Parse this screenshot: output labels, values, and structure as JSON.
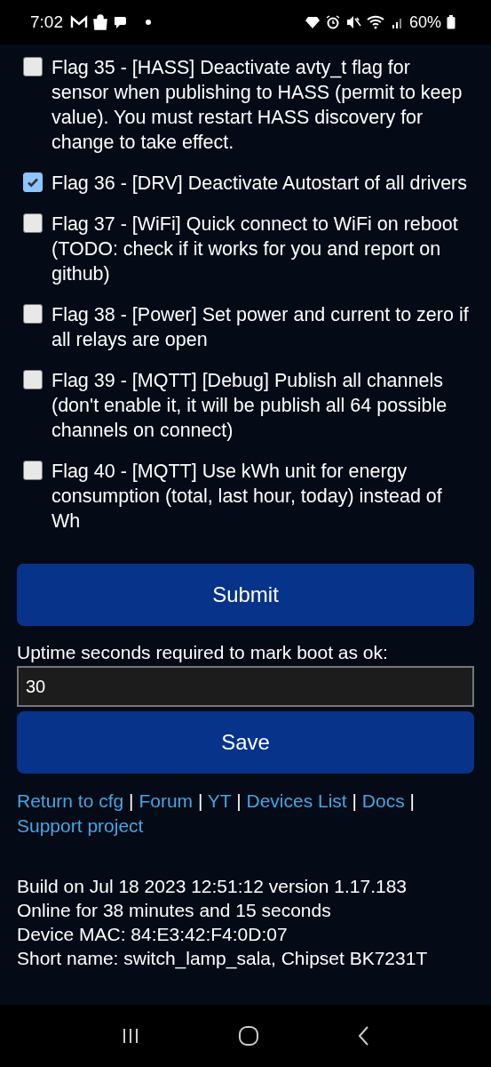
{
  "status_bar": {
    "time": "7:02",
    "battery": "60%"
  },
  "flags": [
    {
      "label": "Flag 35 - [HASS] Deactivate avty_t flag for sensor when publishing to HASS (permit to keep value). You must restart HASS discovery for change to take effect.",
      "checked": false
    },
    {
      "label": "Flag 36 - [DRV] Deactivate Autostart of all drivers",
      "checked": true
    },
    {
      "label": "Flag 37 - [WiFi] Quick connect to WiFi on reboot (TODO: check if it works for you and report on github)",
      "checked": false
    },
    {
      "label": "Flag 38 - [Power] Set power and current to zero if all relays are open",
      "checked": false
    },
    {
      "label": "Flag 39 - [MQTT] [Debug] Publish all channels (don't enable it, it will be publish all 64 possible channels on connect)",
      "checked": false
    },
    {
      "label": "Flag 40 - [MQTT] Use kWh unit for energy consumption (total, last hour, today) instead of Wh",
      "checked": false
    }
  ],
  "submit_button": "Submit",
  "uptime": {
    "label": "Uptime seconds required to mark boot as ok:",
    "value": "30"
  },
  "save_button": "Save",
  "links": [
    {
      "kind": "link",
      "label": "Return to cfg"
    },
    {
      "kind": "separator",
      "label": "|"
    },
    {
      "kind": "link",
      "label": "Forum"
    },
    {
      "kind": "separator",
      "label": "|"
    },
    {
      "kind": "link",
      "label": "YT"
    },
    {
      "kind": "separator",
      "label": "|"
    },
    {
      "kind": "link",
      "label": "Devices List"
    },
    {
      "kind": "separator",
      "label": "|"
    },
    {
      "kind": "link",
      "label": "Docs"
    },
    {
      "kind": "separator",
      "label": "|"
    },
    {
      "kind": "link",
      "label": "Support project"
    }
  ],
  "info": [
    "Build on Jul 18 2023 12:51:12 version 1.17.183",
    "Online for 38 minutes and 15 seconds",
    "Device MAC: 84:E3:42:F4:0D:07",
    "Short name: switch_lamp_sala, Chipset BK7231T"
  ]
}
